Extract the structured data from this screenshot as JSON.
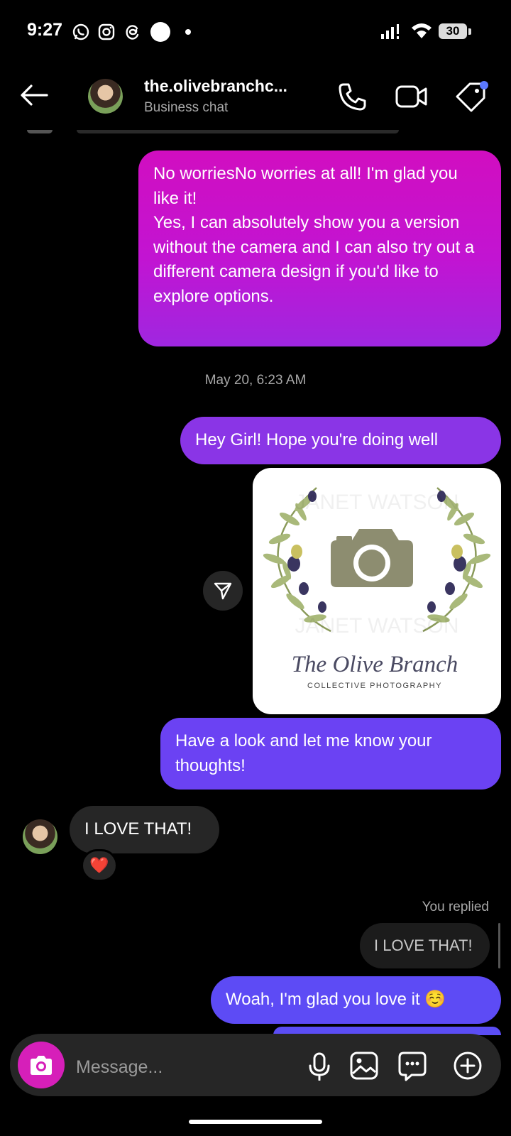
{
  "status_bar": {
    "time": "9:27",
    "battery": "30"
  },
  "header": {
    "name": "the.olivebranchc...",
    "subtitle": "Business chat"
  },
  "messages": {
    "m1": "No worriesNo worries at all! I'm glad you like it!\nYes, I can absolutely show you a version without the camera and I can also try out a different camera design if you'd like to explore options.",
    "timestamp": "May 20, 6:23 AM",
    "m2": "Hey Girl! Hope you're doing well",
    "image": {
      "title": "The Olive Branch",
      "subtitle": "COLLECTIVE PHOTOGRAPHY",
      "watermark": "JANET WATSON"
    },
    "m3": "Have a look and let me know your thoughts!",
    "m4": "I LOVE THAT!",
    "reaction": "❤️",
    "replied_label": "You replied",
    "quoted": "I LOVE THAT!",
    "m5": "Woah, I'm glad you love it ☺️"
  },
  "composer": {
    "placeholder": "Message..."
  },
  "icons": {
    "back": "arrow-left-icon",
    "call": "phone-icon",
    "video": "video-icon",
    "tag": "tag-icon",
    "share": "send-icon",
    "camera": "camera-icon",
    "mic": "microphone-icon",
    "gallery": "image-icon",
    "sticker": "sticker-icon",
    "add": "plus-icon"
  },
  "colors": {
    "accent_dot": "#5b79ff",
    "camera_button": "#d61fb9"
  }
}
